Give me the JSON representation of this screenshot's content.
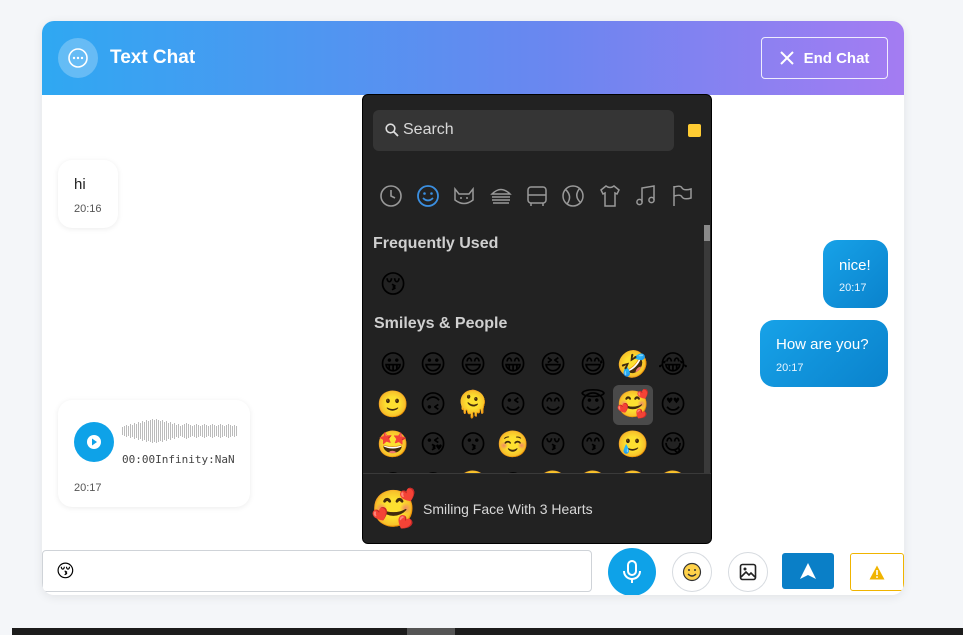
{
  "header": {
    "title": "Text Chat",
    "end_chat_label": "End Chat"
  },
  "messages": [
    {
      "side": "in",
      "text": "hi",
      "time": "20:16"
    },
    {
      "side": "out",
      "text": "nice!",
      "time": "20:17"
    },
    {
      "side": "out",
      "text": "How are you?",
      "time": "20:17"
    },
    {
      "side": "in",
      "type": "audio",
      "audio_time": "00:00Infinity:NaN",
      "time": "20:17"
    }
  ],
  "input": {
    "emoji": "😚",
    "placeholder": ""
  },
  "picker": {
    "search_placeholder": "Search",
    "skin_tone_color": "#ffcc33",
    "categories": [
      "recent-icon",
      "smileys-icon",
      "animals-icon",
      "food-icon",
      "travel-icon",
      "activities-icon",
      "objects-icon",
      "symbols-icon",
      "flags-icon"
    ],
    "active_category": "smileys-icon",
    "sections": {
      "frequent_title": "Frequently Used",
      "frequent": [
        "😚"
      ],
      "smileys_title": "Smileys & People",
      "smileys": [
        [
          "😀",
          "😃",
          "😄",
          "😁",
          "😆",
          "😅",
          "🤣",
          "😂"
        ],
        [
          "🙂",
          "🙃",
          "🫠",
          "😉",
          "😊",
          "😇",
          "🥰",
          "😍"
        ],
        [
          "🤩",
          "😘",
          "😗",
          "☺️",
          "😚",
          "😙",
          "🥲",
          "😋"
        ],
        [
          "😛",
          "😜",
          "🤪",
          "😝",
          "🤑",
          "🤗",
          "🤭",
          "🫢"
        ]
      ],
      "selected": "🥰"
    },
    "preview": {
      "emoji": "🥰",
      "name": "Smiling Face With 3 Hearts"
    }
  },
  "colors": {
    "accent": "#0ea2e8",
    "send": "#0a7fc7",
    "warning": "#f0b400"
  }
}
